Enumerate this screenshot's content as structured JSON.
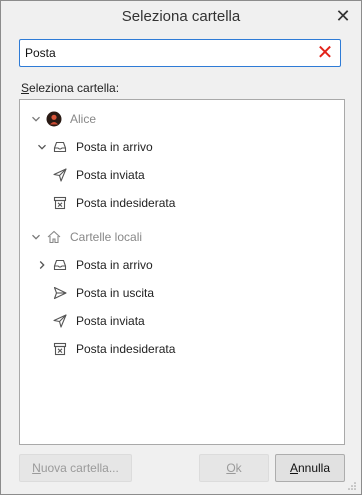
{
  "dialog": {
    "title": "Seleziona cartella",
    "close_icon": "close-icon"
  },
  "search": {
    "value": "Posta",
    "clear_icon": "clear-search-icon",
    "clear_color": "#e2231a"
  },
  "section_label_prefix": "S",
  "section_label_rest": "eleziona cartella:",
  "tree": {
    "accounts": [
      {
        "name": "Alice",
        "expanded": true,
        "icon": "avatar-icon",
        "folders": [
          {
            "label": "Posta in arrivo",
            "icon": "inbox-icon",
            "expandable": true,
            "expanded": true
          },
          {
            "label": "Posta inviata",
            "icon": "sent-icon"
          },
          {
            "label": "Posta indesiderata",
            "icon": "junk-icon"
          }
        ]
      },
      {
        "name": "Cartelle locali",
        "expanded": true,
        "icon": "home-icon",
        "folders": [
          {
            "label": "Posta in arrivo",
            "icon": "inbox-icon",
            "expandable": true,
            "expanded": false
          },
          {
            "label": "Posta in uscita",
            "icon": "outbox-icon"
          },
          {
            "label": "Posta inviata",
            "icon": "sent-icon"
          },
          {
            "label": "Posta indesiderata",
            "icon": "junk-icon"
          }
        ]
      }
    ]
  },
  "buttons": {
    "new_folder_prefix": "N",
    "new_folder_rest": "uova cartella...",
    "ok_prefix": "O",
    "ok_rest": "k",
    "cancel_prefix": "A",
    "cancel_rest": "nnulla"
  }
}
